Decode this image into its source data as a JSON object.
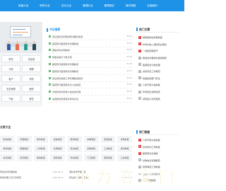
{
  "nav": {
    "items": [
      "制度大全",
      "职责大全",
      "范文大全",
      "管理办法",
      "管理规定",
      "操作规程",
      "实施细则"
    ]
  },
  "banner": {
    "image": "meeting-room-illustration"
  },
  "categories": [
    "财务",
    "实验室",
    "行政",
    "薪酬",
    "客户",
    "采购",
    "安全管理",
    "医院",
    "气象",
    "食堂"
  ],
  "today": {
    "title": "今日推荐",
    "items": [
      {
        "text": "违法违纪和问题线索试器及答复",
        "date": "06-01"
      },
      {
        "text": "医院现代医院院长管理制度",
        "date": "05-31"
      },
      {
        "text": "钢板材料采购验收",
        "date": "05-30"
      },
      {
        "text": "党委食堂打卡登记表",
        "date": "05-29"
      },
      {
        "text": "医院现代医院院长管理制度",
        "date": "05-28"
      },
      {
        "text": "医院现代医院院长管理制度",
        "date": "05-27"
      },
      {
        "text": "建设项目档案工作管理制度规范",
        "date": "05-26"
      },
      {
        "text": "医院现代医院院长办公会制度",
        "date": "05-25"
      },
      {
        "text": "市政府定向安排土地征收管理",
        "date": "05-24"
      },
      {
        "text": "关键岗位职责目标考评办法",
        "date": "05-23"
      }
    ]
  },
  "hot": {
    "title": "热门文章",
    "items": [
      {
        "num": "1",
        "text": "保密各岗位职责制度"
      },
      {
        "num": "2",
        "text": "水利水电二建区职业规划"
      },
      {
        "num": "3",
        "text": "一线直营服务节"
      },
      {
        "num": "4",
        "text": "各地合并事务的组织精简"
      },
      {
        "num": "5",
        "text": "医院院长行政管理"
      },
      {
        "num": "6",
        "text": "资管存实工作规范"
      },
      {
        "num": "7",
        "text": "防疫防控部门安全"
      },
      {
        "num": "8",
        "text": "人民代表大会制度"
      },
      {
        "num": "9",
        "text": "年终安全消防检查"
      },
      {
        "num": "10",
        "text": "领导班子作风规范"
      }
    ]
  },
  "section": {
    "title": "分类大全",
    "tags": [
      "职责制度",
      "管理制度",
      "账务制度",
      "宿舍制度",
      "教学制度",
      "车辆制度",
      "值班制度",
      "考勤制度",
      "财务制度",
      "薪酬制度",
      "公司制度",
      "仓库制度",
      "安全制度",
      "采购制度",
      "工资制度",
      "培训制度",
      "会议制度",
      "合同制度",
      "档案制度",
      "销售制度",
      "学生制度",
      "门卫制度",
      "保安制度",
      "卫生制度"
    ],
    "list": [
      {
        "text": "劳动合同管理制度",
        "date": "2022-05-31"
      },
      {
        "text": "团队协作管理制度",
        "date": "2022-05-31"
      },
      {
        "text": "财务管理人员工作规范",
        "date": "2022-05-30"
      },
      {
        "text": "学生会管理制度汇编",
        "date": "2022-05-30"
      }
    ]
  },
  "hot2": {
    "title": "热门制度",
    "items": [
      {
        "num": "1",
        "text": "人民代表大会制度"
      },
      {
        "num": "2",
        "text": "合作协作工作制度"
      },
      {
        "num": "3",
        "text": "医院院长负责制"
      },
      {
        "num": "4",
        "text": "采购信息管理规范"
      },
      {
        "num": "5",
        "text": "财务审核工作制度"
      },
      {
        "num": "6",
        "text": "卫生检查评比办法"
      },
      {
        "num": "7",
        "text": "保安值勤制度"
      }
    ]
  },
  "watermark": {
    "text": "小 为 范 文 网"
  },
  "colors": {
    "primary": "#1d92e6",
    "accent": "#e53935",
    "green": "#3aa65b"
  }
}
